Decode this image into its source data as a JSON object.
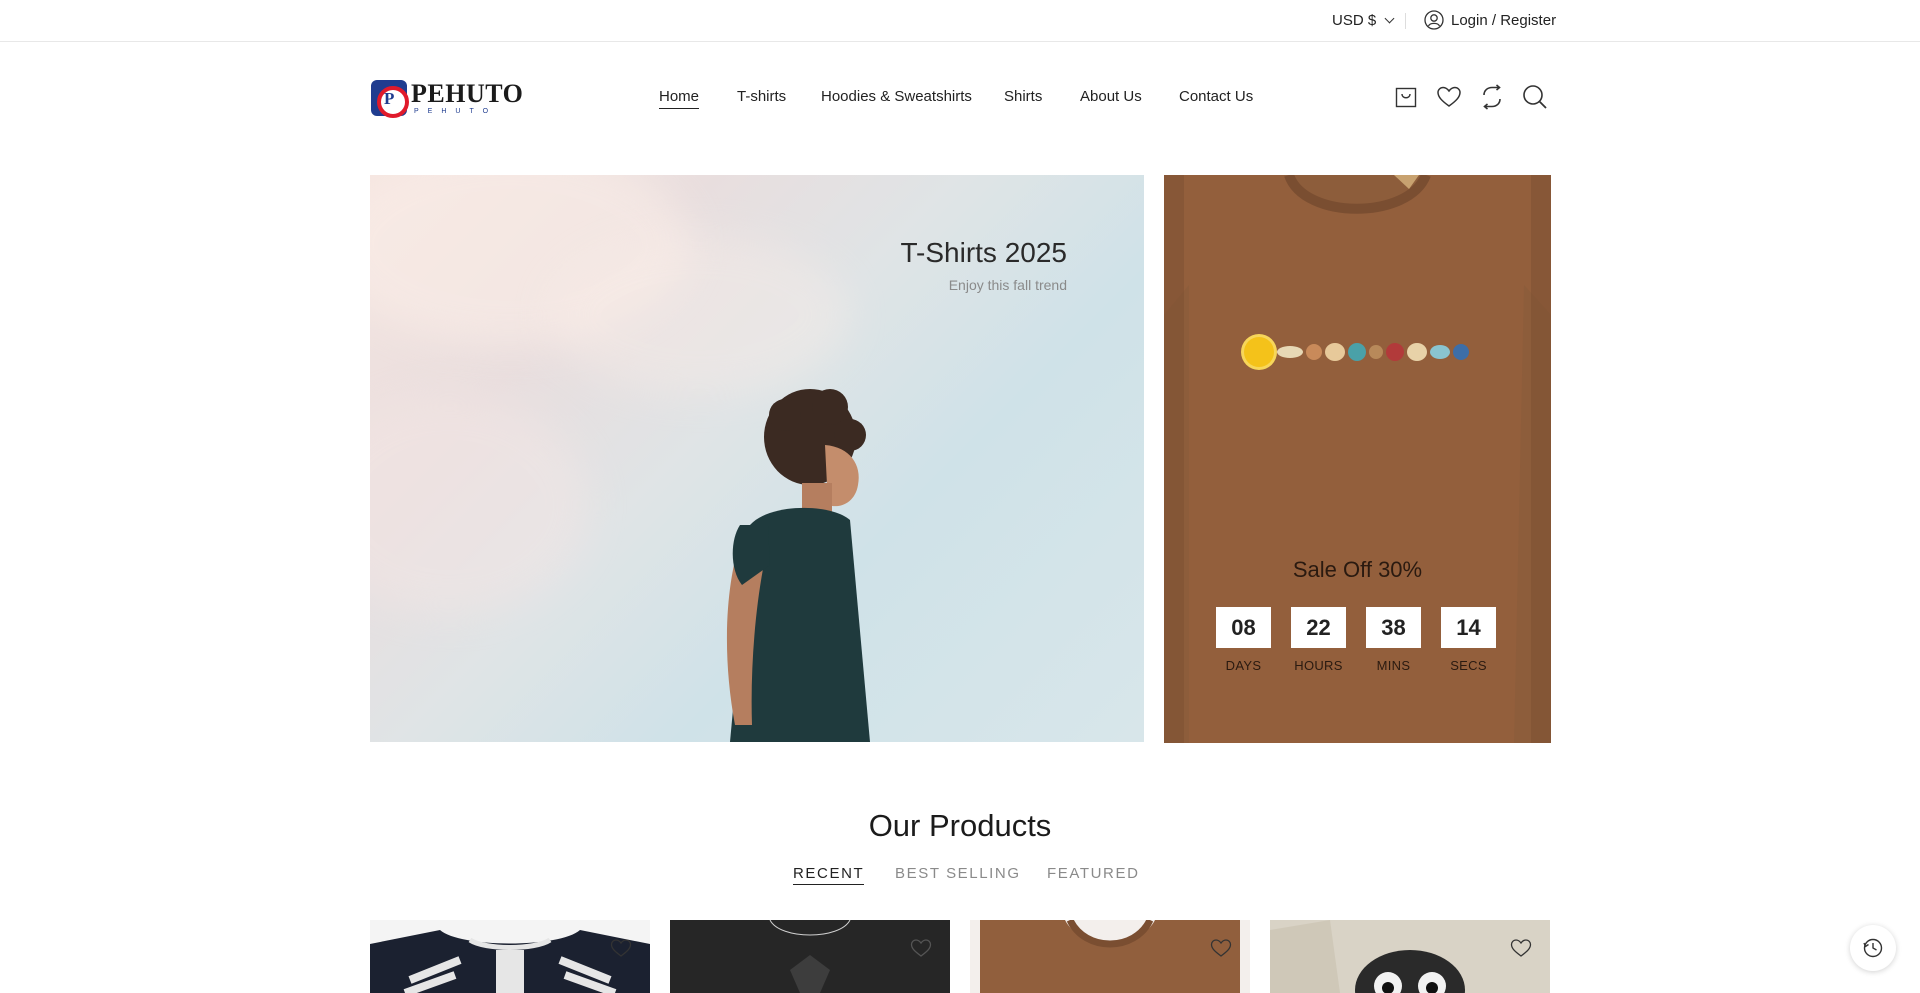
{
  "topbar": {
    "currency_label": "USD $",
    "login_label": "Login / Register"
  },
  "logo": {
    "name": "PEHUTO",
    "tagline": "PEHUTO"
  },
  "nav": {
    "items": [
      {
        "label": "Home",
        "active": true
      },
      {
        "label": "T-shirts",
        "active": false
      },
      {
        "label": "Hoodies & Sweatshirts",
        "active": false
      },
      {
        "label": "Shirts",
        "active": false
      },
      {
        "label": "About Us",
        "active": false
      },
      {
        "label": "Contact Us",
        "active": false
      }
    ]
  },
  "header_icons": [
    "cart-icon",
    "heart-icon",
    "compare-icon",
    "search-icon"
  ],
  "hero": {
    "title": "T-Shirts 2025",
    "subtitle": "Enjoy this fall trend"
  },
  "promo": {
    "sale_text": "Sale Off 30%",
    "countdown": [
      {
        "value": "08",
        "label": "DAYS"
      },
      {
        "value": "22",
        "label": "HOURS"
      },
      {
        "value": "38",
        "label": "MINS"
      },
      {
        "value": "14",
        "label": "SECS"
      }
    ]
  },
  "products_section": {
    "title": "Our Products",
    "tabs": [
      {
        "label": "RECENT",
        "active": true
      },
      {
        "label": "BEST SELLING",
        "active": false
      },
      {
        "label": "FEATURED",
        "active": false
      }
    ]
  },
  "colors": {
    "accent": "#222222",
    "promo_bg": "#8f5f3c",
    "muted": "#8a8a8a"
  }
}
